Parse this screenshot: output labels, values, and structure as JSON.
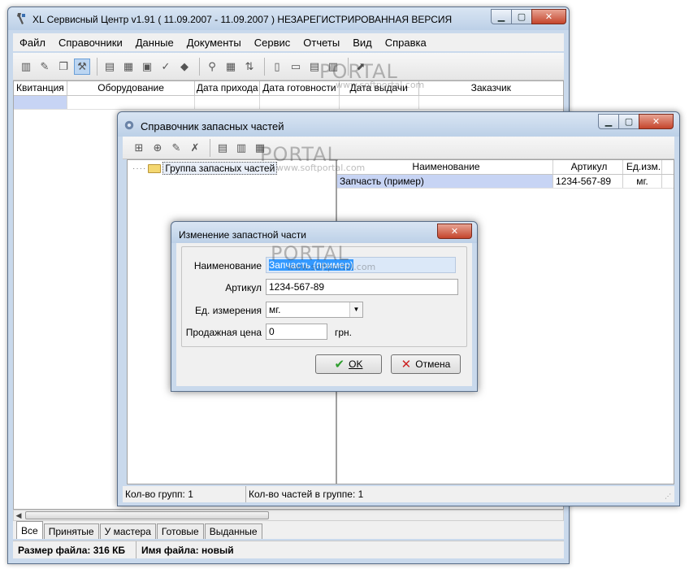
{
  "main": {
    "title": "XL Сервисный Центр v1.91    ( 11.09.2007 - 11.09.2007 ) НЕЗАРЕГИСТРИРОВАННАЯ ВЕРСИЯ",
    "menu": [
      "Файл",
      "Справочники",
      "Данные",
      "Документы",
      "Сервис",
      "Отчеты",
      "Вид",
      "Справка"
    ],
    "columns": [
      "Квитанция",
      "Оборудование",
      "Дата прихода",
      "Дата готовности",
      "Дата выдачи",
      "Заказчик"
    ],
    "tabs": [
      "Все",
      "Принятые",
      "У мастера",
      "Готовые",
      "Выданные"
    ],
    "status": {
      "file_size": "Размер файла: 316 КБ",
      "file_name": "Имя файла: новый"
    }
  },
  "parts_window": {
    "title": "Справочник запасных частей",
    "tree_root": "Группа запасных частей",
    "columns": [
      "Наименование",
      "Артикул",
      "Ед.изм."
    ],
    "rows": [
      {
        "name": "Запчасть (пример)",
        "article": "1234-567-89",
        "unit": "мг."
      }
    ],
    "status": {
      "groups": "Кол-во групп: 1",
      "parts": "Кол-во частей в группе: 1"
    }
  },
  "dialog": {
    "title": "Изменение запастной части",
    "labels": {
      "name": "Наименование",
      "article": "Артикул",
      "unit": "Ед. измерения",
      "price": "Продажная цена",
      "currency": "грн."
    },
    "values": {
      "name": "Запчасть (пример)",
      "article": "1234-567-89",
      "unit": "мг.",
      "price": "0"
    },
    "buttons": {
      "ok": "OK",
      "cancel": "Отмена"
    }
  },
  "watermark": {
    "brand": "PORTAL",
    "url": "www.softportal.com"
  },
  "colors": {
    "selection": "#c7d4f4",
    "close_button": "#c4452c",
    "ok_icon": "#2e9e2e",
    "cancel_icon": "#cc2222"
  }
}
